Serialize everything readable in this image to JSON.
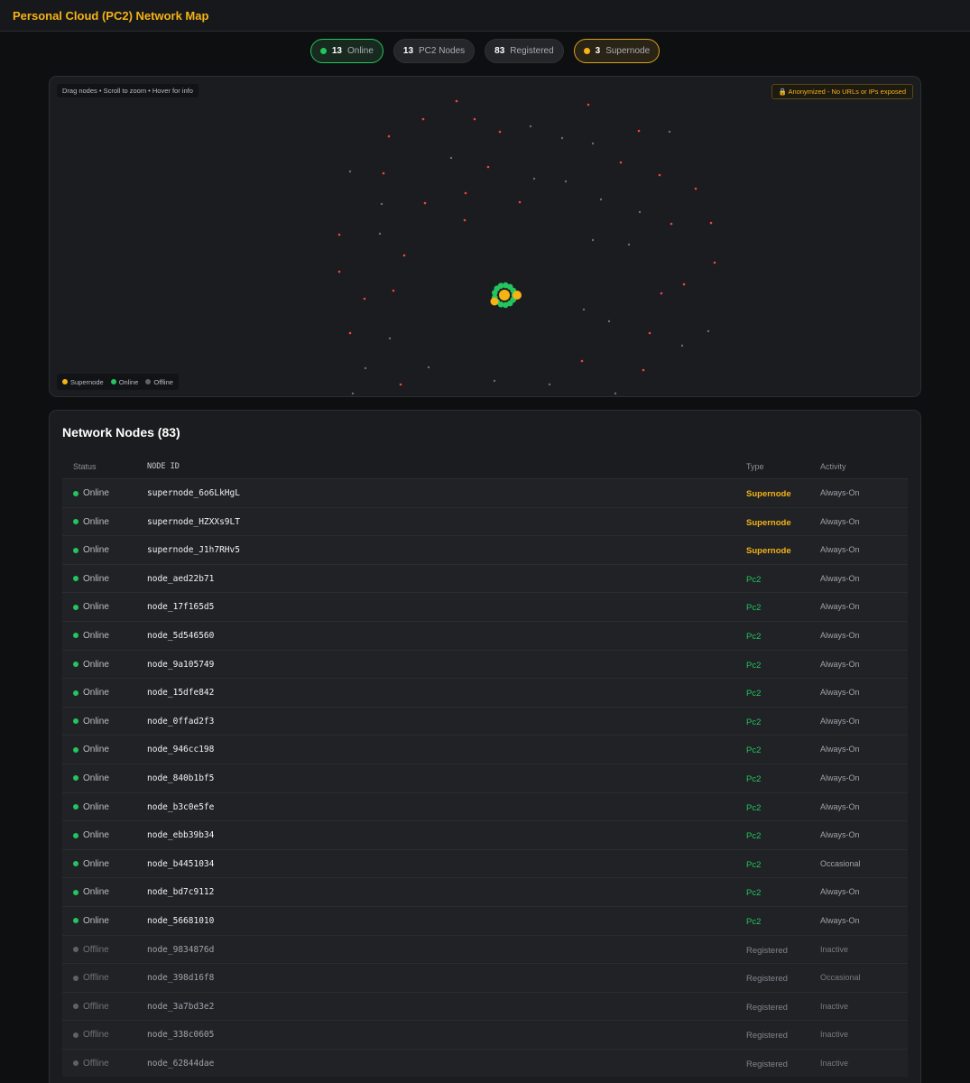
{
  "header": {
    "title": "Personal Cloud (PC2) Network Map"
  },
  "stats": {
    "online": {
      "value": "13",
      "label": "Online"
    },
    "pc2": {
      "value": "13",
      "label": "PC2 Nodes"
    },
    "registered": {
      "value": "83",
      "label": "Registered"
    },
    "supernode": {
      "value": "3",
      "label": "Supernode"
    }
  },
  "map": {
    "hint": "Drag nodes • Scroll to zoom • Hover for info",
    "anon_badge": "🔒 Anonymized - No URLs or IPs exposed",
    "legend": {
      "supernode": "Supernode",
      "online": "Online",
      "offline": "Offline"
    },
    "colors": {
      "supernode": "#f5b316",
      "online": "#22c55e",
      "offline_red": "#ef4444",
      "offline_gray": "#6b7076"
    }
  },
  "nodes": {
    "title": "Network Nodes (83)",
    "columns": {
      "status": "Status",
      "node_id": "NODE ID",
      "type": "Type",
      "activity": "Activity"
    },
    "rows": [
      {
        "status": "Online",
        "id": "supernode_6o6LkHgL",
        "type": "Supernode",
        "activity": "Always-On"
      },
      {
        "status": "Online",
        "id": "supernode_HZXXs9LT",
        "type": "Supernode",
        "activity": "Always-On"
      },
      {
        "status": "Online",
        "id": "supernode_J1h7RHv5",
        "type": "Supernode",
        "activity": "Always-On"
      },
      {
        "status": "Online",
        "id": "node_aed22b71",
        "type": "Pc2",
        "activity": "Always-On"
      },
      {
        "status": "Online",
        "id": "node_17f165d5",
        "type": "Pc2",
        "activity": "Always-On"
      },
      {
        "status": "Online",
        "id": "node_5d546560",
        "type": "Pc2",
        "activity": "Always-On"
      },
      {
        "status": "Online",
        "id": "node_9a105749",
        "type": "Pc2",
        "activity": "Always-On"
      },
      {
        "status": "Online",
        "id": "node_15dfe842",
        "type": "Pc2",
        "activity": "Always-On"
      },
      {
        "status": "Online",
        "id": "node_0ffad2f3",
        "type": "Pc2",
        "activity": "Always-On"
      },
      {
        "status": "Online",
        "id": "node_946cc198",
        "type": "Pc2",
        "activity": "Always-On"
      },
      {
        "status": "Online",
        "id": "node_840b1bf5",
        "type": "Pc2",
        "activity": "Always-On"
      },
      {
        "status": "Online",
        "id": "node_b3c0e5fe",
        "type": "Pc2",
        "activity": "Always-On"
      },
      {
        "status": "Online",
        "id": "node_ebb39b34",
        "type": "Pc2",
        "activity": "Always-On"
      },
      {
        "status": "Online",
        "id": "node_b4451034",
        "type": "Pc2",
        "activity": "Occasional"
      },
      {
        "status": "Online",
        "id": "node_bd7c9112",
        "type": "Pc2",
        "activity": "Always-On"
      },
      {
        "status": "Online",
        "id": "node_56681010",
        "type": "Pc2",
        "activity": "Always-On"
      },
      {
        "status": "Offline",
        "id": "node_9834876d",
        "type": "Registered",
        "activity": "Inactive"
      },
      {
        "status": "Offline",
        "id": "node_398d16f8",
        "type": "Registered",
        "activity": "Occasional"
      },
      {
        "status": "Offline",
        "id": "node_3a7bd3e2",
        "type": "Registered",
        "activity": "Inactive"
      },
      {
        "status": "Offline",
        "id": "node_338c0605",
        "type": "Registered",
        "activity": "Inactive"
      },
      {
        "status": "Offline",
        "id": "node_62844dae",
        "type": "Registered",
        "activity": "Inactive"
      }
    ]
  }
}
